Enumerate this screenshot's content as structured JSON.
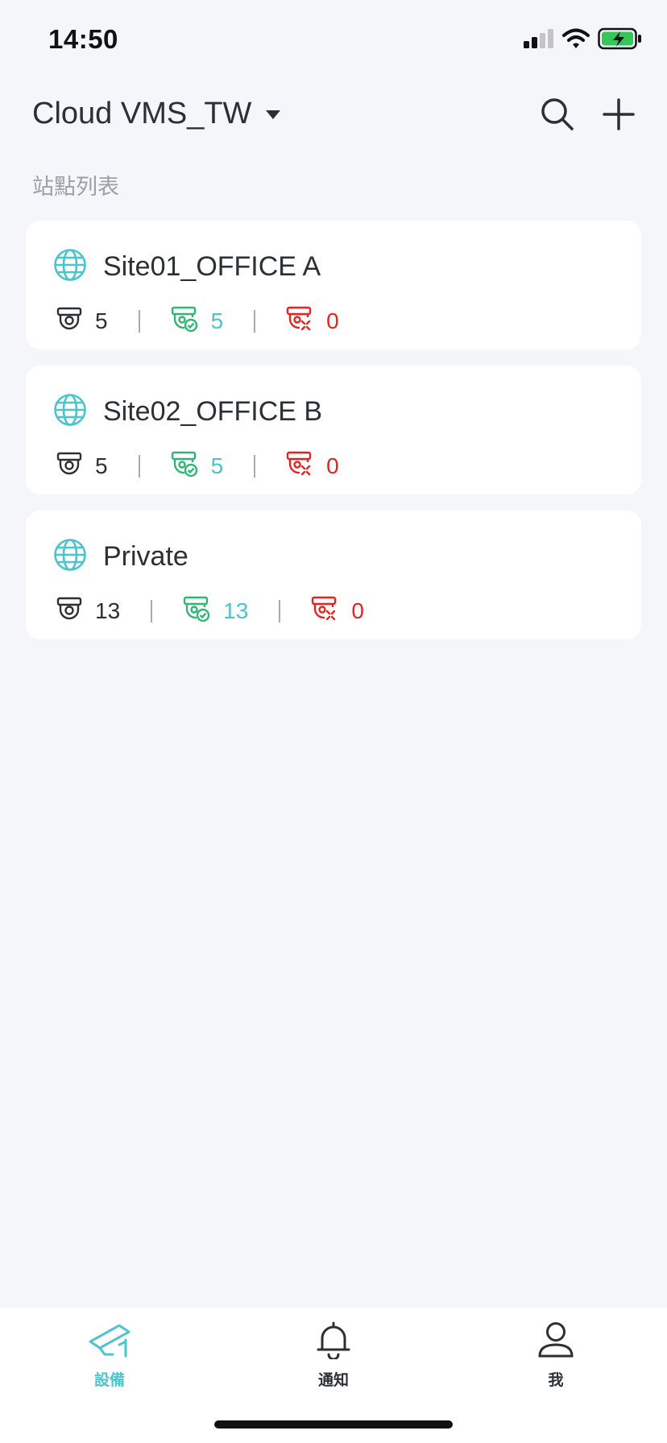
{
  "status_bar": {
    "time": "14:50"
  },
  "header": {
    "workspace_title": "Cloud VMS_TW",
    "search_icon": "search-icon",
    "add_icon": "plus-icon"
  },
  "section_label": "站點列表",
  "sites": [
    {
      "name": "Site01_OFFICE A",
      "total": "5",
      "online": "5",
      "offline": "0"
    },
    {
      "name": "Site02_OFFICE B",
      "total": "5",
      "online": "5",
      "offline": "0"
    },
    {
      "name": "Private",
      "total": "13",
      "online": "13",
      "offline": "0"
    }
  ],
  "bottom_nav": [
    {
      "label": "設備",
      "icon": "camera-icon",
      "active": true
    },
    {
      "label": "通知",
      "icon": "bell-icon",
      "active": false
    },
    {
      "label": "我",
      "icon": "person-icon",
      "active": false
    }
  ],
  "colors": {
    "accent": "#4cc4cc",
    "online_green": "#2fb673",
    "offline_red": "#e8231f",
    "background": "#f4f6fa"
  }
}
